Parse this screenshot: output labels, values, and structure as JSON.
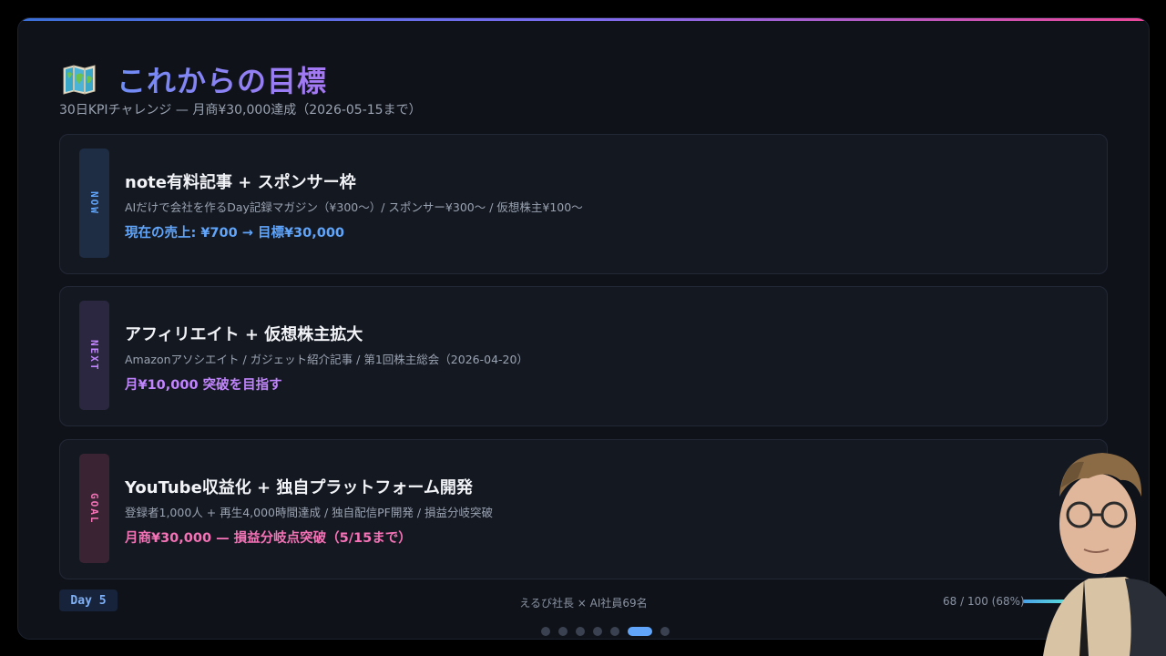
{
  "slide": {
    "title": "これからの目標",
    "title_icon": "world-map-icon",
    "subtitle": "30日KPIチャレンジ — 月商¥30,000達成（2026-05-15まで）"
  },
  "cards": [
    {
      "tag": "NOW",
      "title": "note有料記事 + スポンサー枠",
      "desc": "AIだけで会社を作るDay記録マガジン（¥300〜）/ スポンサー¥300〜 / 仮想株主¥100〜",
      "emphasis": "現在の売上: ¥700 → 目標¥30,000",
      "accent": "#60a5fa"
    },
    {
      "tag": "NEXT",
      "title": "アフィリエイト + 仮想株主拡大",
      "desc": "Amazonアソシエイト / ガジェット紹介記事 / 第1回株主総会（2026-04-20）",
      "emphasis": "月¥10,000 突破を目指す",
      "accent": "#c084fc"
    },
    {
      "tag": "GOAL",
      "title": "YouTube収益化 + 独自プラットフォーム開発",
      "desc": "登録者1,000人 + 再生4,000時間達成 / 独自配信PF開発 / 損益分岐突破",
      "emphasis": "月商¥30,000 — 損益分岐点突破（5/15まで）",
      "accent": "#f472b6"
    }
  ],
  "footer": {
    "day_badge": "Day 5",
    "center_text": "えるび社長 × AI社員69名",
    "progress_text": "68 / 100 (68%)",
    "progress_value": 0.68
  },
  "pagination": {
    "total": 7,
    "active_index": 5
  }
}
